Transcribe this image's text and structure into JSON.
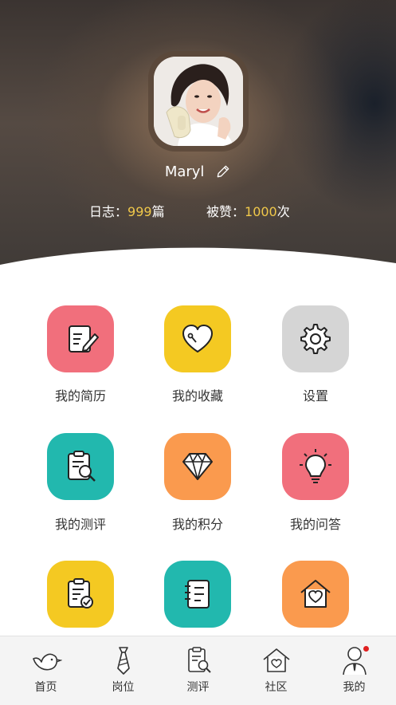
{
  "profile": {
    "username": "Maryl",
    "stats": {
      "log_label": "日志：",
      "log_count": "999",
      "log_unit": "篇",
      "like_label": "被赞：",
      "like_count": "1000",
      "like_unit": "次"
    }
  },
  "menu": {
    "items": [
      {
        "label": "我的简历",
        "icon": "resume-icon",
        "color": "#f16f7c"
      },
      {
        "label": "我的收藏",
        "icon": "heart-tag-icon",
        "color": "#f4c922"
      },
      {
        "label": "设置",
        "icon": "gear-icon",
        "color": "#d5d5d5"
      },
      {
        "label": "我的测评",
        "icon": "clipboard-search-icon",
        "color": "#22b8ae"
      },
      {
        "label": "我的积分",
        "icon": "diamond-icon",
        "color": "#fa9a4e"
      },
      {
        "label": "我的问答",
        "icon": "lightbulb-icon",
        "color": "#f16f7c"
      },
      {
        "label": "",
        "icon": "clipboard-check-icon",
        "color": "#f4c922"
      },
      {
        "label": "",
        "icon": "notebook-icon",
        "color": "#22b8ae"
      },
      {
        "label": "",
        "icon": "heart-house-icon",
        "color": "#fa9a4e"
      }
    ]
  },
  "tabbar": {
    "tabs": [
      {
        "label": "首页",
        "icon": "bird-icon"
      },
      {
        "label": "岗位",
        "icon": "tie-icon"
      },
      {
        "label": "测评",
        "icon": "clipboard-search-icon"
      },
      {
        "label": "社区",
        "icon": "heart-house-icon"
      },
      {
        "label": "我的",
        "icon": "person-icon",
        "has_badge": true
      }
    ]
  },
  "colors": {
    "accent_number": "#f0c84a",
    "badge": "#e02020"
  }
}
